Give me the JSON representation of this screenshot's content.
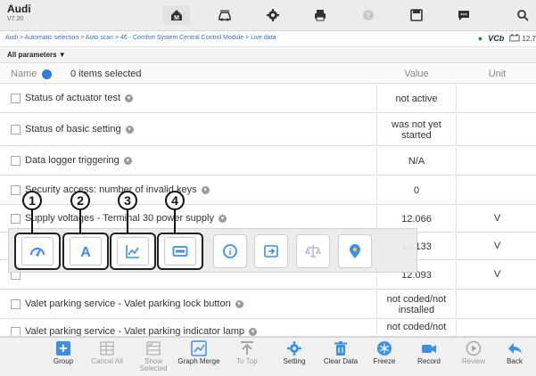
{
  "header": {
    "brand": "Audi",
    "version": "V7.20"
  },
  "breadcrumb": {
    "path": "Audi > Automatic selection > Auto scan > 46 - Comfort System Central Control Module > Live data",
    "vcb": "VCb",
    "voltage": "12.7"
  },
  "filter": {
    "label": "All parameters ▼"
  },
  "table": {
    "headers": {
      "name": "Name",
      "selected": "0 items selected",
      "value": "Value",
      "unit": "Unit"
    },
    "rows": [
      {
        "label": "Status of actuator test",
        "value": "not active",
        "unit": ""
      },
      {
        "label": "Status of basic setting",
        "value": "was not yet started",
        "unit": ""
      },
      {
        "label": "Data logger triggering",
        "value": "N/A",
        "unit": ""
      },
      {
        "label": "Security access: number of invalid keys",
        "value": "0",
        "unit": ""
      },
      {
        "label": "Supply voltages - Terminal 30 power supply",
        "value": "12.066",
        "unit": "V"
      },
      {
        "label": "",
        "value": "12.133",
        "unit": "V"
      },
      {
        "label": "",
        "value": "12.093",
        "unit": "V"
      },
      {
        "label": "Valet parking service - Valet parking lock button",
        "value": "not coded/not installed",
        "unit": ""
      },
      {
        "label": "Valet parking service - Valet parking indicator lamp",
        "value": "not coded/not",
        "unit": ""
      }
    ]
  },
  "callouts": [
    "1",
    "2",
    "3",
    "4"
  ],
  "bottom_toolbar": {
    "group": "Group",
    "cancel_all": "Cancel All",
    "show_selected": "Show Selected",
    "graph_merge": "Graph Merge",
    "to_top": "To Top",
    "setting": "Setting",
    "clear_data": "Clear Data",
    "freeze": "Freeze",
    "record": "Record",
    "review": "Review",
    "back": "Back"
  },
  "colors": {
    "accent_blue": "#2f7de0",
    "toolbar_blue": "#3a8fe8"
  }
}
